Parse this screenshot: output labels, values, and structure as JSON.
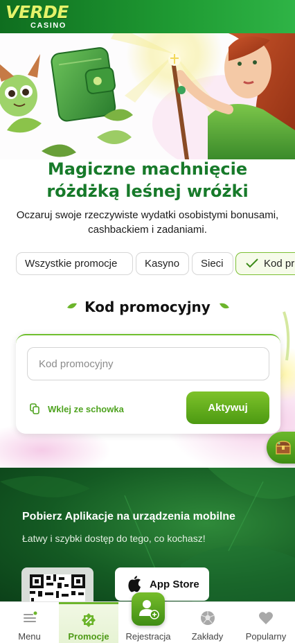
{
  "header": {
    "logo_main": "VERDE",
    "logo_sub": "CASINO"
  },
  "hero": {
    "title_line1": "Magiczne machnięcie",
    "title_line2": "różdżką leśnej wróżki",
    "subtitle": "Oczaruj swoje rzeczywiste wydatki osobistymi bonusami, cashbackiem i zadaniami."
  },
  "filters": {
    "items": [
      {
        "label": "Wszystkie promocje",
        "active": false
      },
      {
        "label": "Kasyno",
        "active": false
      },
      {
        "label": "Sieci",
        "active": false
      },
      {
        "label": "Kod pr",
        "active": true
      }
    ]
  },
  "promo": {
    "section_title": "Kod promocyjny",
    "input_placeholder": "Kod promocyjny",
    "input_value": "",
    "paste_label": "Wklej ze schowka",
    "activate_label": "Aktywuj"
  },
  "app_banner": {
    "title": "Pobierz Aplikacje na urządzenia mobilne",
    "subtitle": "Łatwy i szybki dostęp do tego, co kochasz!",
    "store_label": "App Store"
  },
  "bottom_nav": {
    "items": [
      {
        "label": "Menu",
        "icon": "menu-icon",
        "active": false
      },
      {
        "label": "Promocje",
        "icon": "promo-badge-icon",
        "active": true
      },
      {
        "label": "Rejestracja",
        "icon": "add-user-icon",
        "active": false
      },
      {
        "label": "Zakłady",
        "icon": "soccer-ball-icon",
        "active": false
      },
      {
        "label": "Popularny",
        "icon": "heart-icon",
        "active": false
      }
    ]
  },
  "colors": {
    "brand_green": "#1f9b33",
    "accent_lime": "#6cb52b",
    "title_green": "#177a2a"
  }
}
